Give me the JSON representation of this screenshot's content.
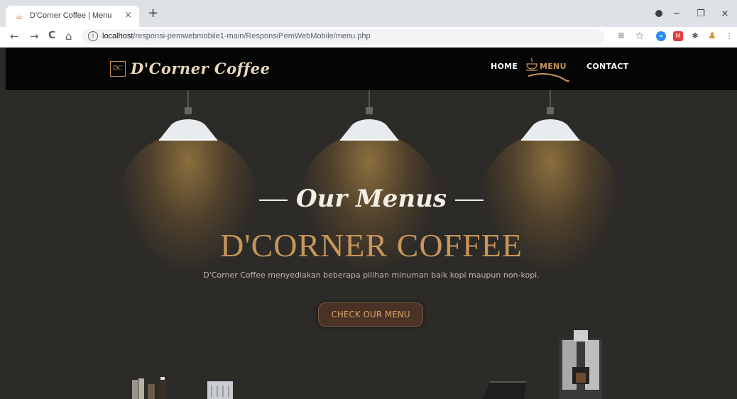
{
  "browser": {
    "tab_title": "D'Corner Coffee | Menu",
    "tab_close": "×",
    "new_tab": "+",
    "url_host": "localhost",
    "url_path": "/responsi-pemwebmobile1-main/ResponsiPemWebMobile/menu.php",
    "back": "←",
    "forward": "→",
    "reload": "C",
    "home": "⌂",
    "info": "i",
    "minimize": "−",
    "restore": "❐",
    "close": "×",
    "menu": "⋮",
    "star": "☆",
    "puzzle": "✱"
  },
  "site": {
    "logo_mark": "DC",
    "logo_text": "D'Corner Coffee",
    "nav": {
      "home": "HOME",
      "menu": "MENU",
      "contact": "CONTACT"
    },
    "accent_color": "#c8955a"
  },
  "hero": {
    "subtitle": "Our Menus",
    "title": "D'CORNER COFFEE",
    "description": "D'Corner Coffee menyediakan beberapa pilihan minuman baik kopi maupun non-kopi.",
    "cta": "CHECK OUR MENU"
  }
}
